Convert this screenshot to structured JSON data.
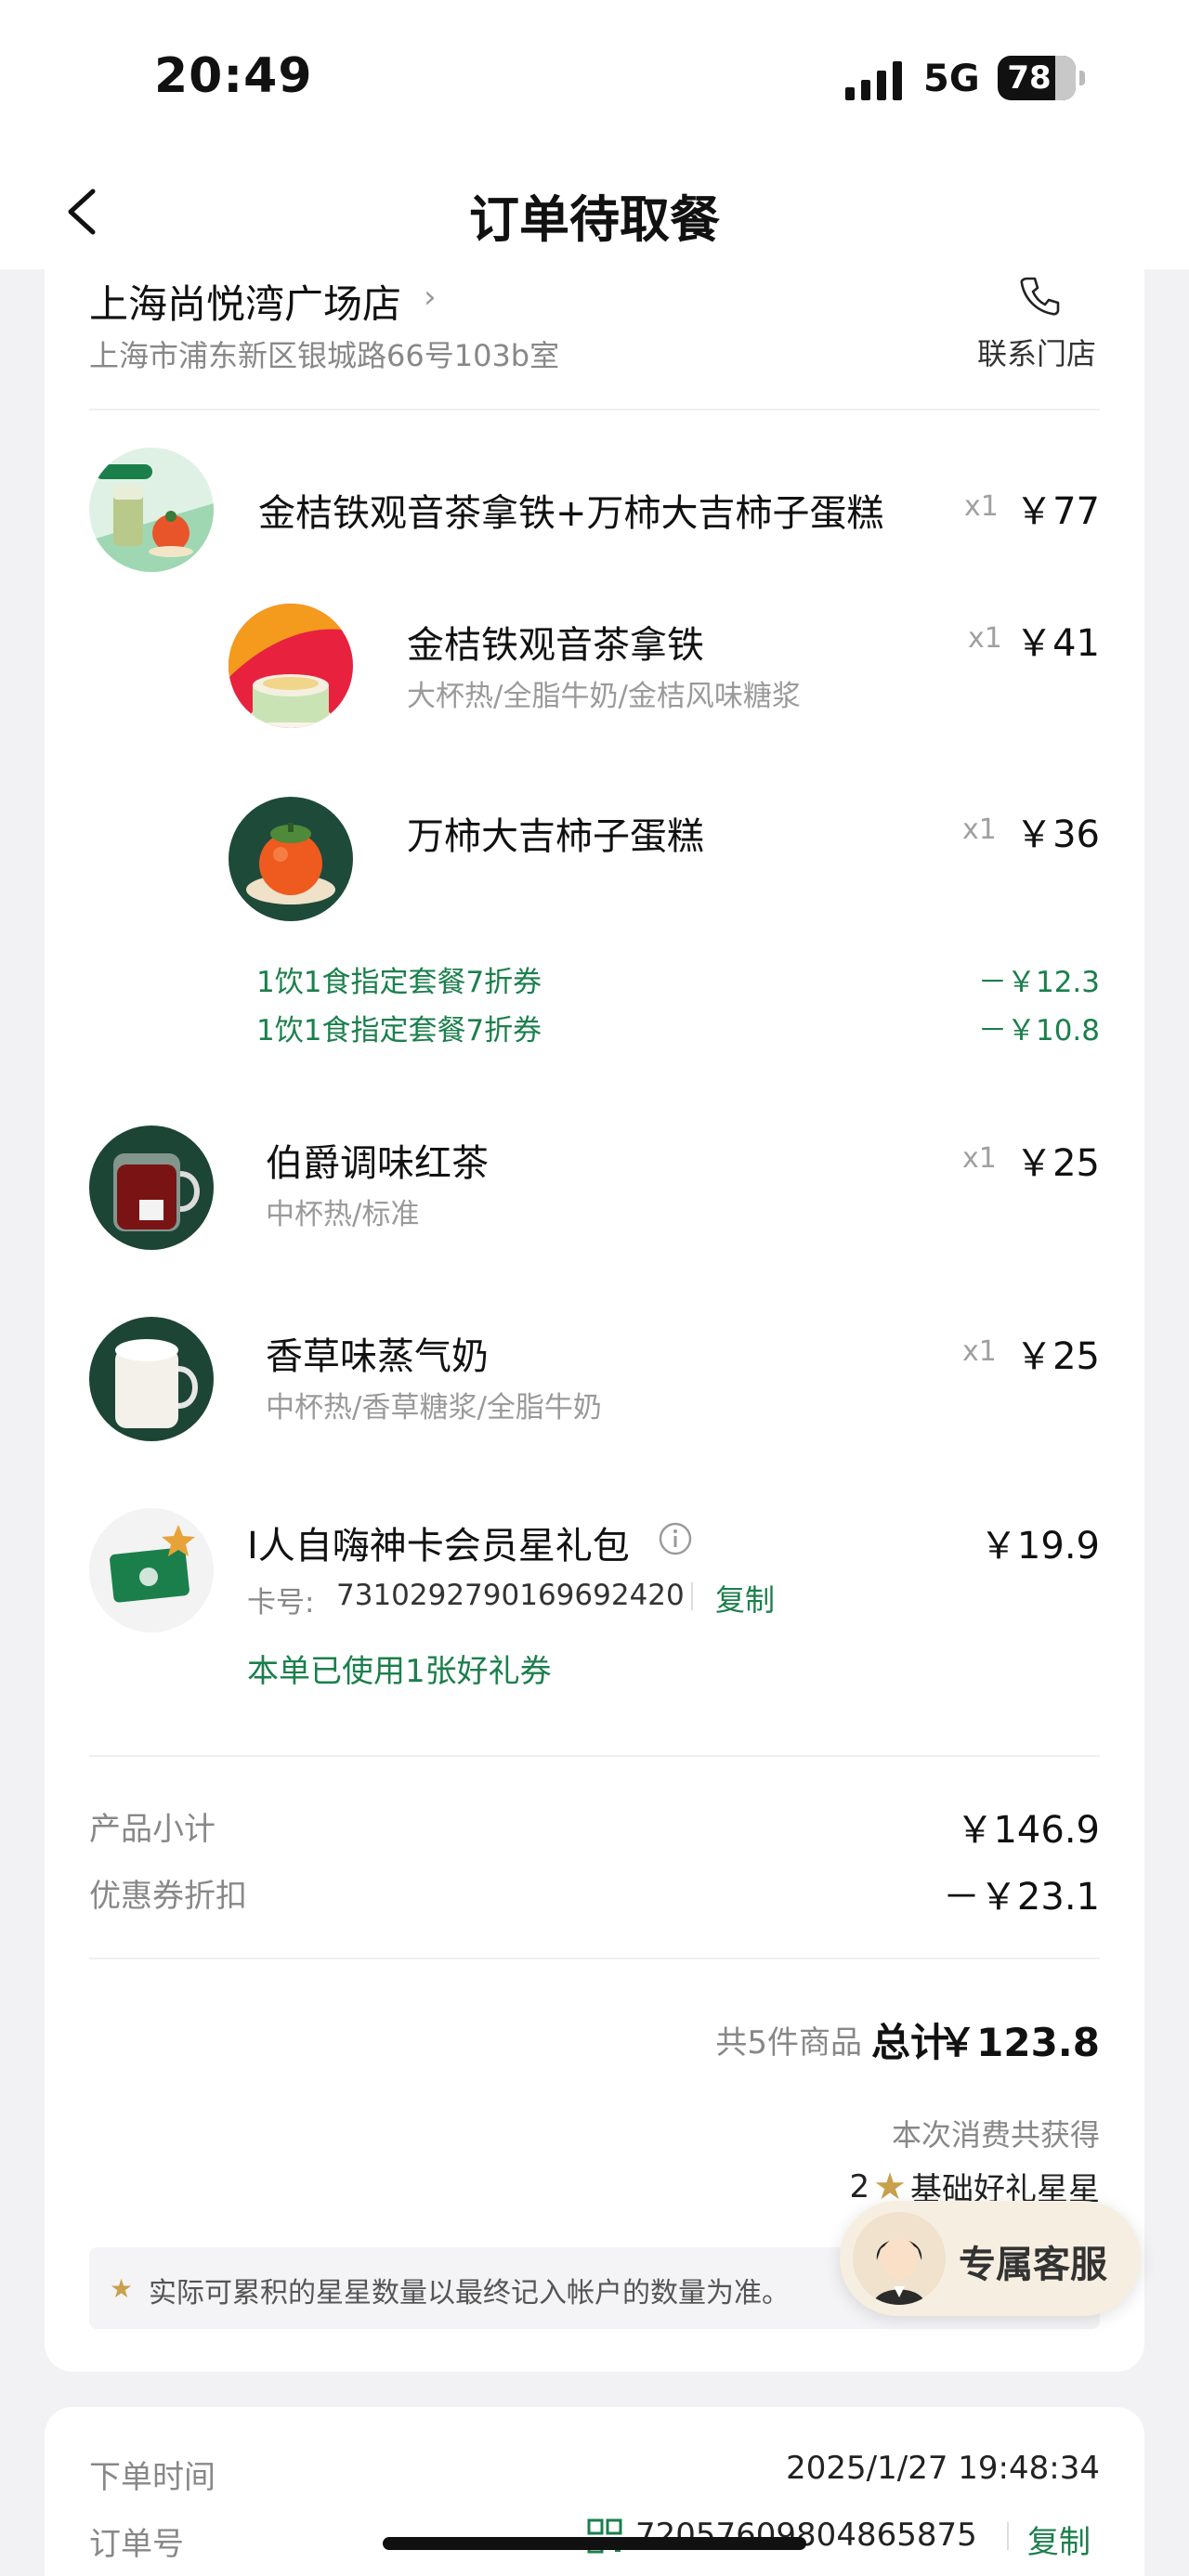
{
  "status_bar": {
    "time": "20:49",
    "network": "5G",
    "battery": "78"
  },
  "nav": {
    "title": "订单待取餐"
  },
  "store": {
    "name": "上海尚悦湾广场店",
    "address": "上海市浦东新区银城路66号103b室",
    "contact_label": "联系门店"
  },
  "combo": {
    "name": "金桔铁观音茶拿铁+万柿大吉柿子蛋糕",
    "qty": "x1",
    "price": "￥77",
    "sub_items": [
      {
        "name": "金桔铁观音茶拿铁",
        "spec": "大杯热/全脂牛奶/金桔风味糖浆",
        "qty": "x1",
        "price": "￥41"
      },
      {
        "name": "万柿大吉柿子蛋糕",
        "spec": "",
        "qty": "x1",
        "price": "￥36"
      }
    ],
    "coupons": [
      {
        "label": "1饮1食指定套餐7折券",
        "amount": "－￥12.3"
      },
      {
        "label": "1饮1食指定套餐7折券",
        "amount": "－￥10.8"
      }
    ]
  },
  "items": [
    {
      "name": "伯爵调味红茶",
      "spec": "中杯热/标准",
      "qty": "x1",
      "price": "￥25"
    },
    {
      "name": "香草味蒸气奶",
      "spec": "中杯热/香草糖浆/全脂牛奶",
      "qty": "x1",
      "price": "￥25"
    }
  ],
  "gift": {
    "name": "I人自嗨神卡会员星礼包",
    "price": "￥19.9",
    "card_label": "卡号:",
    "card_number": "7310292790169692420",
    "copy_label": "复制",
    "used_note": "本单已使用1张好礼券"
  },
  "summary": {
    "subtotal_label": "产品小计",
    "subtotal": "￥146.9",
    "discount_label": "优惠券折扣",
    "discount": "－￥23.1",
    "count_label": "共5件商品",
    "total_label": "总计",
    "total": "￥123.8",
    "stars_title": "本次消费共获得",
    "stars_count": "2",
    "stars_label": "基础好礼星星",
    "note": "实际可累积的星星数量以最终记入帐户的数量为准。"
  },
  "customer_service": {
    "label": "专属客服"
  },
  "order_info": {
    "time_label": "下单时间",
    "time": "2025/1/27 19:48:34",
    "number_label": "订单号",
    "number": "72057609804865875",
    "copy_label": "复制"
  },
  "colors": {
    "brand_green": "#1b7f4c",
    "star_gold": "#c9a04b"
  }
}
